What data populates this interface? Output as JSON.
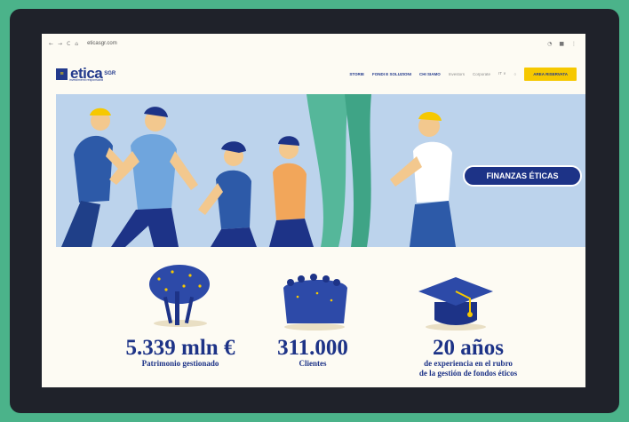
{
  "browser": {
    "url": "eticasgr.com",
    "nav": [
      "←",
      "→",
      "C",
      "⌂"
    ]
  },
  "header": {
    "logo_mark": "≡",
    "logo_text": "etica",
    "logo_sub": "SGR",
    "tagline": "investimenti responsabili",
    "menu_items": [
      "STORIE",
      "FONDI E SOLUZIONI",
      "CHI SIAMO"
    ],
    "menu_secondary": [
      "Investors",
      "Corporate",
      "IT ∨"
    ],
    "cta_label": "AREA RISERVATA"
  },
  "hero": {
    "button_label": "FINANZAS ÉTICAS"
  },
  "stats": [
    {
      "value": "5.339 mln €",
      "caption": "Patrimonio gestionado"
    },
    {
      "value": "311.000",
      "caption": "Clientes"
    },
    {
      "value": "20 años",
      "caption": "de experiencia en el rubro",
      "caption2": "de la gestión de fondos éticos"
    }
  ],
  "colors": {
    "background": "#4bb38a",
    "device": "#1f222a",
    "navy": "#1d3387",
    "yellow": "#f6c800",
    "hero_bg": "#bcd3ec"
  },
  "icons": [
    "tree-icon",
    "crowd-icon",
    "graduation-cap-icon"
  ]
}
